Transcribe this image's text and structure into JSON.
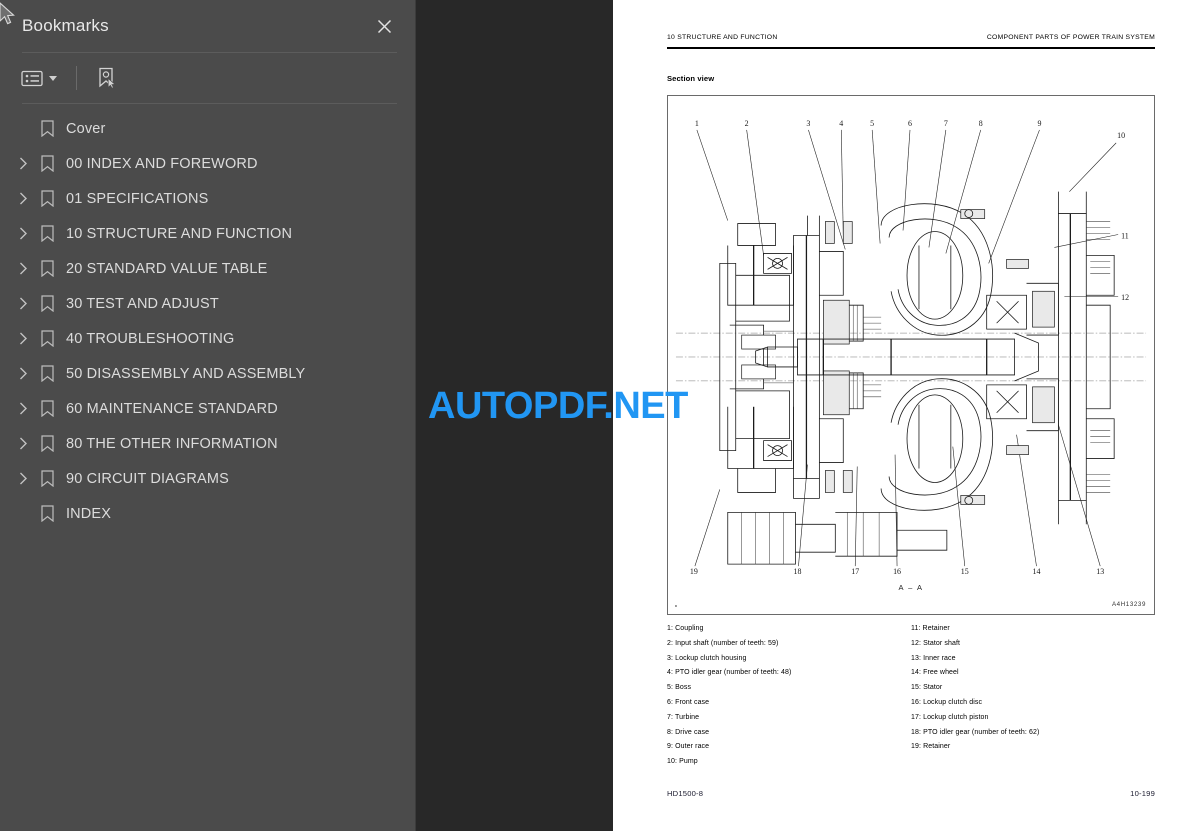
{
  "sidebar": {
    "panel_title": "Bookmarks",
    "close_icon": "close-icon",
    "toolbar": {
      "list_options_icon": "list-options-icon",
      "bookmark_pointer_icon": "bookmark-select-icon"
    },
    "items": [
      {
        "label": "Cover",
        "expandable": false
      },
      {
        "label": "00 INDEX AND FOREWORD",
        "expandable": true
      },
      {
        "label": "01 SPECIFICATIONS",
        "expandable": true
      },
      {
        "label": "10 STRUCTURE AND FUNCTION",
        "expandable": true
      },
      {
        "label": "20 STANDARD VALUE TABLE",
        "expandable": true
      },
      {
        "label": "30 TEST AND ADJUST",
        "expandable": true
      },
      {
        "label": "40 TROUBLESHOOTING",
        "expandable": true
      },
      {
        "label": "50 DISASSEMBLY AND ASSEMBLY",
        "expandable": true
      },
      {
        "label": "60 MAINTENANCE STANDARD",
        "expandable": true
      },
      {
        "label": "80 THE OTHER INFORMATION",
        "expandable": true
      },
      {
        "label": "90 CIRCUIT DIAGRAMS",
        "expandable": true
      },
      {
        "label": "INDEX",
        "expandable": false
      }
    ]
  },
  "watermark": {
    "text": "AUTOPDF.NET",
    "color": "#2196f3"
  },
  "page": {
    "header_left": "10 STRUCTURE AND FUNCTION",
    "header_right": "COMPONENT PARTS OF POWER TRAIN SYSTEM",
    "section_label": "Section view",
    "figure": {
      "section_title": "A – A",
      "drawing_code": "A4H13239",
      "callouts_top": [
        "1",
        "2",
        "3",
        "4",
        "5",
        "6",
        "7",
        "8",
        "9",
        "10"
      ],
      "callouts_right": [
        "11",
        "12"
      ],
      "callouts_bottom": [
        "19",
        "18",
        "17",
        "16",
        "15",
        "14",
        "13"
      ]
    },
    "legend_left": [
      "1: Coupling",
      "2: Input shaft (number of teeth: 59)",
      "3: Lockup clutch housing",
      "4: PTO idler gear (number of teeth: 48)",
      "5: Boss",
      "6: Front case",
      "7: Turbine",
      "8: Drive case",
      "9: Outer race",
      "10: Pump"
    ],
    "legend_right": [
      "11: Retainer",
      "12: Stator shaft",
      "13: Inner race",
      "14: Free wheel",
      "15: Stator",
      "16: Lockup clutch disc",
      "17: Lockup clutch piston",
      "18: PTO idler gear (number of teeth: 62)",
      "19: Retainer"
    ],
    "footer_left": "HD1500-8",
    "footer_right": "10-199"
  }
}
